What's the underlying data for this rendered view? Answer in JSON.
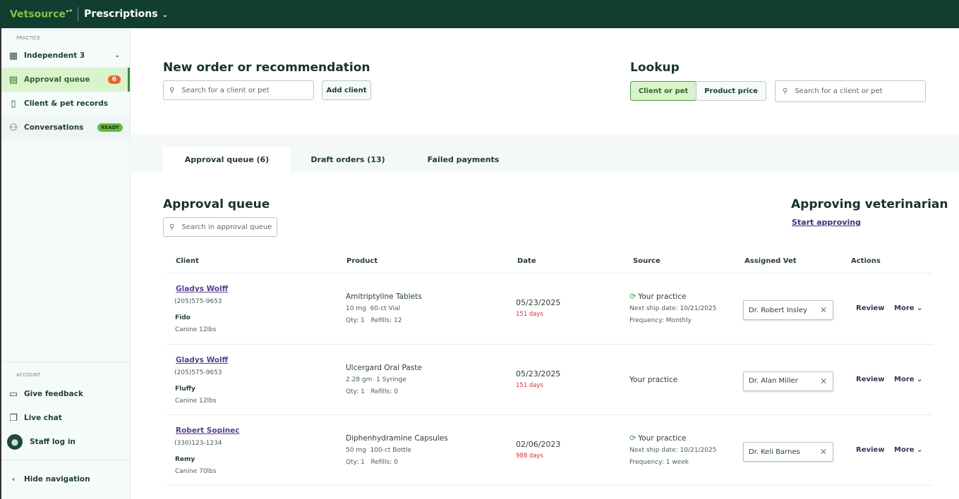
{
  "header": {
    "brand": "Vetsource",
    "app_title": "Prescriptions"
  },
  "sidebar": {
    "practice_label": "PRACTICE",
    "practice_name": "Independent 3",
    "items": [
      {
        "label": "Approval queue",
        "badge": "6"
      },
      {
        "label": "Client & pet records"
      },
      {
        "label": "Conversations",
        "badge": "READY"
      }
    ],
    "account_label": "ACCOUNT",
    "account_items": [
      {
        "label": "Give feedback"
      },
      {
        "label": "Live chat"
      },
      {
        "label": "Staff log in"
      }
    ],
    "hide_nav": "Hide navigation"
  },
  "new_order": {
    "title": "New order or recommendation",
    "search_placeholder": "Search for a client or pet",
    "add_client": "Add client"
  },
  "lookup": {
    "title": "Lookup",
    "toggle": [
      "Client or pet",
      "Product price"
    ],
    "search_placeholder": "Search for a client or pet"
  },
  "tabs": [
    "Approval queue (6)",
    "Draft orders (13)",
    "Failed payments"
  ],
  "queue": {
    "title": "Approval queue",
    "search_placeholder": "Search in approval queue",
    "vet_title": "Approving veterinarian",
    "start_link": "Start approving"
  },
  "columns": [
    "Client",
    "Product",
    "Date",
    "Source",
    "Assigned Vet",
    "Actions"
  ],
  "rows": [
    {
      "client": "Gladys Wolff",
      "phone": "(205)575-9653",
      "pet": "Fido",
      "species": "Canine 12lbs",
      "product": "Amitriptyline Tablets",
      "strength": "10 mg  60-ct Vial",
      "qty": "Qty: 1   Refills: 12",
      "date": "05/23/2025",
      "age": "151 days",
      "source": "Your practice",
      "ship": "Next ship date: 10/21/2025",
      "freq": "Frequency: Monthly",
      "vet": "Dr. Robert Insley",
      "review": "Review",
      "more": "More"
    },
    {
      "client": "Gladys Wolff",
      "phone": "(205)575-9653",
      "pet": "Fluffy",
      "species": "Canine 12lbs",
      "product": "Ulcergard Oral Paste",
      "strength": "2.28 gm  1 Syringe",
      "qty": "Qty: 1   Refills: 0",
      "date": "05/23/2025",
      "age": "151 days",
      "source": "Your practice",
      "vet": "Dr. Alan Miller",
      "review": "Review",
      "more": "More"
    },
    {
      "client": "Robert Sopinec",
      "phone": "(330)123-1234",
      "pet": "Remy",
      "species": "Canine 70lbs",
      "product": "Diphenhydramine Capsules",
      "strength": "50 mg  100-ct Bottle",
      "qty": "Qty: 1   Refills: 0",
      "date": "02/06/2023",
      "age": "988 days",
      "source": "Your practice",
      "ship": "Next ship date: 10/21/2025",
      "freq": "Frequency: 1 week",
      "vet": "Dr. Keli Barnes",
      "review": "Review",
      "more": "More"
    }
  ]
}
